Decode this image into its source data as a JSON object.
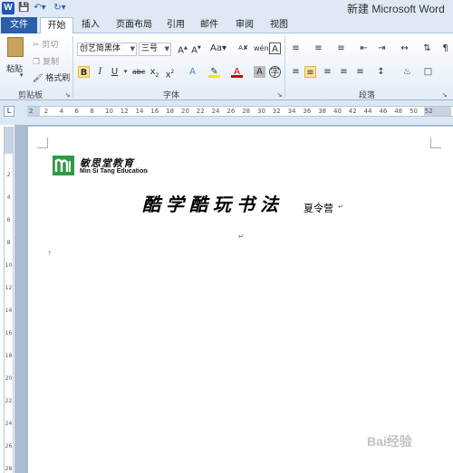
{
  "title_bar": {
    "app_icon": "W",
    "title": "新建 Microsoft Word"
  },
  "tabs": [
    {
      "label": "文件"
    },
    {
      "label": "开始"
    },
    {
      "label": "插入"
    },
    {
      "label": "页面布局"
    },
    {
      "label": "引用"
    },
    {
      "label": "邮件"
    },
    {
      "label": "审阅"
    },
    {
      "label": "视图"
    }
  ],
  "clipboard": {
    "paste": "粘贴",
    "cut": "剪切",
    "copy": "复制",
    "format_painter": "格式刷",
    "label": "剪贴板"
  },
  "font": {
    "name": "创艺简黑体",
    "size": "三号",
    "label": "字体"
  },
  "paragraph": {
    "label": "段落"
  },
  "ruler_numbers": [
    "2",
    "2",
    "4",
    "6",
    "8",
    "10",
    "12",
    "14",
    "16",
    "18",
    "20",
    "22",
    "24",
    "26",
    "28",
    "30",
    "32",
    "34",
    "36",
    "38",
    "40",
    "42",
    "44",
    "46",
    "48",
    "50",
    "52"
  ],
  "vruler_numbers": [
    "2",
    "4",
    "6",
    "8",
    "10",
    "12",
    "14",
    "16",
    "18",
    "20",
    "22",
    "24",
    "26",
    "28"
  ],
  "document": {
    "logo_cn": "敏思堂教育",
    "logo_en": "Min Si Tang Education",
    "title": "酷学酷玩书法",
    "subtitle": "夏令营",
    "paragraph_mark": "↵"
  },
  "watermark": "Bai经验"
}
